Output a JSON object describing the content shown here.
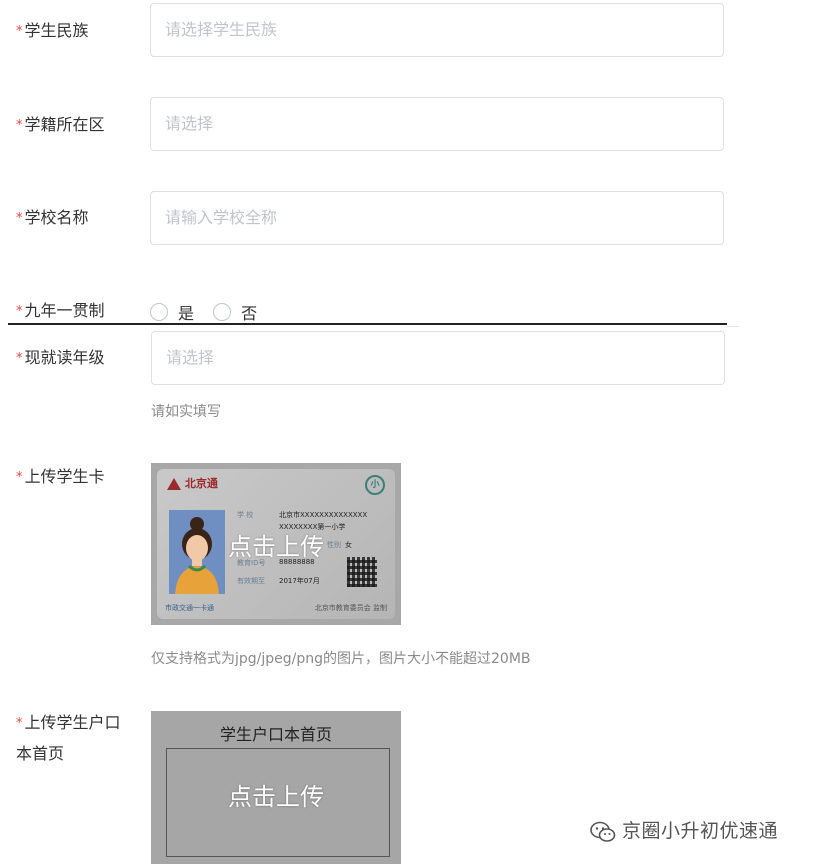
{
  "form": {
    "ethnicity": {
      "label": "学生民族",
      "placeholder": "请选择学生民族"
    },
    "district": {
      "label": "学籍所在区",
      "placeholder": "请选择"
    },
    "school_name": {
      "label": "学校名称",
      "placeholder": "请输入学校全称"
    },
    "nine_year": {
      "label": "九年一贯制",
      "options": [
        "是",
        "否"
      ]
    },
    "grade": {
      "label": "现就读年级",
      "placeholder": "请选择",
      "hint": "请如实填写"
    },
    "student_card": {
      "label": "上传学生卡",
      "upload_text": "点击上传",
      "hint": "仅支持格式为jpg/jpeg/png的图片，图片大小不能超过20MB",
      "sample": {
        "logo_text": "北京通",
        "badge": "小",
        "school_label": "学  校",
        "school_value_1": "北京市XXXXXXXXXXXXXX",
        "school_value_2": "XXXXXXXX第一小学",
        "gender_label": "性别",
        "gender_value": "女",
        "id_label": "教育ID号",
        "id_value": "88888888",
        "valid_label": "有效期至",
        "valid_value": "2017年07月",
        "footer_left": "市政交通一卡通",
        "footer_right": "北京市教育委员会 监制"
      }
    },
    "hukou": {
      "label": "上传学生户口本首页",
      "title": "学生户口本首页",
      "upload_text": "点击上传"
    }
  },
  "required_mark": "*",
  "watermark": "京圈小升初优速通",
  "colors": {
    "required": "#e64545",
    "placeholder": "#c0c4cc",
    "border": "#dcdfe6",
    "hint": "#8a8a8a"
  }
}
